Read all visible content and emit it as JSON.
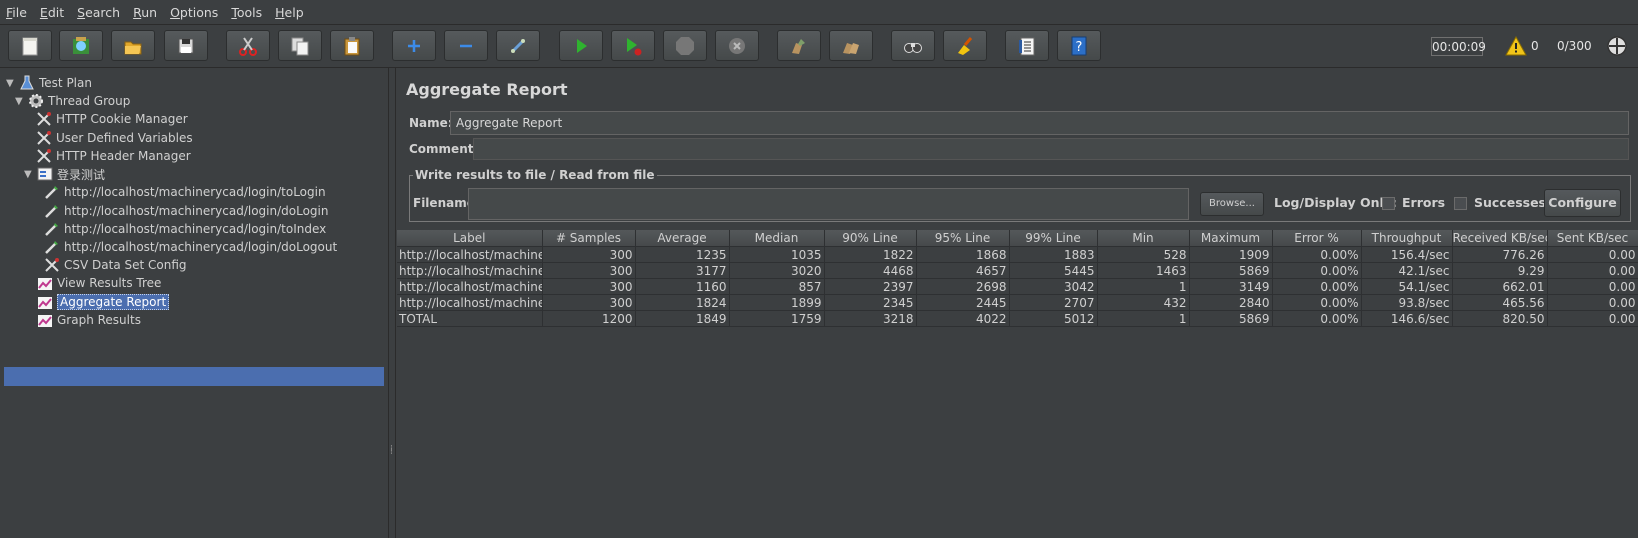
{
  "menu": [
    {
      "label": "File",
      "mn": "F",
      "rest": "ile"
    },
    {
      "label": "Edit",
      "mn": "E",
      "rest": "dit"
    },
    {
      "label": "Search",
      "mn": "S",
      "rest": "earch"
    },
    {
      "label": "Run",
      "mn": "R",
      "rest": "un"
    },
    {
      "label": "Options",
      "mn": "O",
      "rest": "ptions"
    },
    {
      "label": "Tools",
      "mn": "T",
      "rest": "ools"
    },
    {
      "label": "Help",
      "mn": "H",
      "rest": "elp"
    }
  ],
  "toolbar": {
    "timer": "00:00:09",
    "warnings": "0",
    "threads": "0/300",
    "icons": [
      "new-icon",
      "templates-icon",
      "open-icon",
      "save-icon",
      "cut-icon",
      "copy-icon",
      "paste-icon",
      "expand-icon",
      "collapse-icon",
      "toggle-icon",
      "start-icon",
      "start-no-pauses-icon",
      "stop-icon",
      "shutdown-icon",
      "clear-icon",
      "clear-all-icon",
      "search-icon",
      "reset-search-icon",
      "function-helper-icon",
      "help-icon"
    ]
  },
  "tree": {
    "test_plan": "Test Plan",
    "thread_group": "Thread Group",
    "cookie_manager": "HTTP Cookie Manager",
    "user_vars": "User Defined Variables",
    "header_manager": "HTTP Header Manager",
    "transaction": "登录测试",
    "sampler_1": "http://localhost/machinerycad/login/toLogin",
    "sampler_2": "http://localhost/machinerycad/login/doLogin",
    "sampler_3": "http://localhost/machinerycad/login/toIndex",
    "sampler_4": "http://localhost/machinerycad/login/doLogout",
    "csv_config": "CSV Data Set Config",
    "view_results_tree": "View Results Tree",
    "aggregate_report": "Aggregate Report",
    "graph_results": "Graph Results"
  },
  "panel": {
    "title": "Aggregate Report",
    "name_label": "Name:",
    "name_value": "Aggregate Report",
    "comments_label": "Comments:",
    "file_legend": "Write results to file / Read from file",
    "filename_label": "Filename",
    "browse_label": "Browse...",
    "log_display_label": "Log/Display Only:",
    "errors_label": "Errors",
    "successes_label": "Successes",
    "configure_label": "Configure"
  },
  "table": {
    "headers": [
      "Label",
      "# Samples",
      "Average",
      "Median",
      "90% Line",
      "95% Line",
      "99% Line",
      "Min",
      "Maximum",
      "Error %",
      "Throughput",
      "Received KB/sec",
      "Sent KB/sec"
    ],
    "rows": [
      [
        "http://localhost/machine...",
        "300",
        "1235",
        "1035",
        "1822",
        "1868",
        "1883",
        "528",
        "1909",
        "0.00%",
        "156.4/sec",
        "776.26",
        "0.00"
      ],
      [
        "http://localhost/machine...",
        "300",
        "3177",
        "3020",
        "4468",
        "4657",
        "5445",
        "1463",
        "5869",
        "0.00%",
        "42.1/sec",
        "9.29",
        "0.00"
      ],
      [
        "http://localhost/machine...",
        "300",
        "1160",
        "857",
        "2397",
        "2698",
        "3042",
        "1",
        "3149",
        "0.00%",
        "54.1/sec",
        "662.01",
        "0.00"
      ],
      [
        "http://localhost/machine...",
        "300",
        "1824",
        "1899",
        "2345",
        "2445",
        "2707",
        "432",
        "2840",
        "0.00%",
        "93.8/sec",
        "465.56",
        "0.00"
      ],
      [
        "TOTAL",
        "1200",
        "1849",
        "1759",
        "3218",
        "4022",
        "5012",
        "1",
        "5869",
        "0.00%",
        "146.6/sec",
        "820.50",
        "0.00"
      ]
    ]
  }
}
